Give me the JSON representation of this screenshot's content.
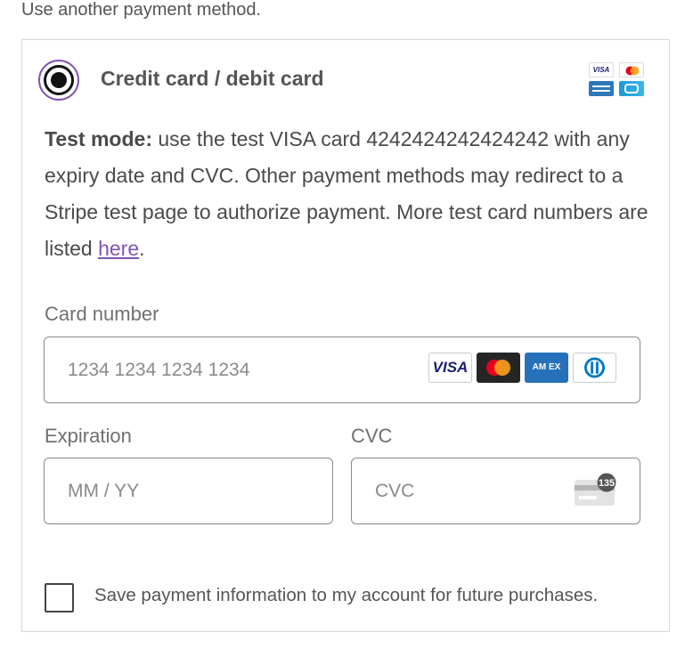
{
  "header": {
    "alt_method_link": "Use another payment method."
  },
  "method": {
    "title": "Credit card / debit card",
    "selected": true,
    "brand_icons": [
      "visa-icon",
      "mastercard-icon",
      "amex-icon",
      "cb-icon"
    ]
  },
  "notice": {
    "bold": "Test mode:",
    "text": " use the test VISA card 4242424242424242 with any expiry date and CVC. Other payment methods may redirect to a Stripe test page to authorize payment. More test card numbers are listed ",
    "link": "here",
    "end": "."
  },
  "card_number": {
    "label": "Card number",
    "placeholder": "1234 1234 1234 1234",
    "icons": [
      "visa-icon",
      "mastercard-icon",
      "amex-icon",
      "diners-icon"
    ],
    "visa_text": "VISA",
    "amex_text": "AM EX"
  },
  "expiration": {
    "label": "Expiration",
    "placeholder": "MM / YY"
  },
  "cvc": {
    "label": "CVC",
    "placeholder": "CVC",
    "icon_badge": "135"
  },
  "save": {
    "label": "Save payment information to my account for future purchases.",
    "checked": false
  },
  "colors": {
    "accent": "#7f54b3",
    "border": "#8a8a8a"
  }
}
